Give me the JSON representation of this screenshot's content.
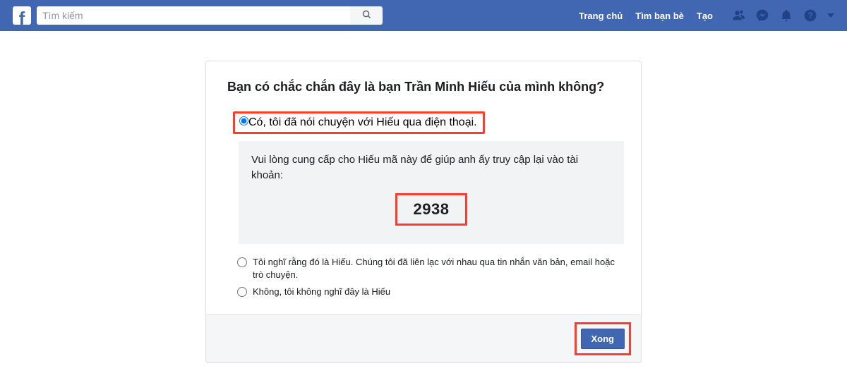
{
  "topbar": {
    "search_placeholder": "Tìm kiếm",
    "nav": {
      "home": "Trang chủ",
      "find_friends": "Tìm bạn bè",
      "create": "Tạo"
    }
  },
  "card": {
    "title": "Bạn có chắc chắn đây là bạn Trần Minh Hiếu của mình không?",
    "options": {
      "opt1": "Có, tôi đã nói chuyện với Hiếu qua điện thoại.",
      "opt2": "Tôi nghĩ rằng đó là Hiếu. Chúng tôi đã liên lạc với nhau qua tin nhắn văn bản, email hoặc trò chuyện.",
      "opt3": "Không, tôi không nghĩ đây là Hiếu"
    },
    "code_prompt": "Vui lòng cung cấp cho Hiếu mã này để giúp anh ấy truy cập lại vào tài khoản:",
    "recovery_code": "2938",
    "done_label": "Xong"
  }
}
